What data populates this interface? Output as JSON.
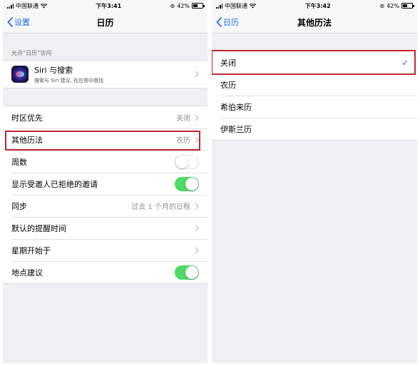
{
  "left": {
    "status": {
      "carrier": "中国联通",
      "time": "下午3:41",
      "battery": "42%"
    },
    "nav": {
      "back": "设置",
      "title": "日历"
    },
    "section_header": "允许“日历”访问",
    "siri": {
      "title": "Siri 与搜索",
      "subtitle": "搜索与 Siri 建议, 在应用中查找"
    },
    "rows": {
      "timezone": {
        "label": "时区优先",
        "value": "关闭"
      },
      "other_calendars": {
        "label": "其他历法",
        "value": "农历"
      },
      "week_numbers": {
        "label": "周数",
        "state": "off"
      },
      "declined": {
        "label": "显示受邀人已拒绝的邀请",
        "state": "on"
      },
      "sync": {
        "label": "同步",
        "value": "过去 1 个月的日程"
      },
      "default_alert": {
        "label": "默认的提醒时间"
      },
      "week_start": {
        "label": "星期开始于"
      },
      "location": {
        "label": "地点建议",
        "state": "on"
      }
    }
  },
  "right": {
    "status": {
      "carrier": "中国联通",
      "time": "下午3:42",
      "battery": "42%"
    },
    "nav": {
      "back": "日历",
      "title": "其他历法"
    },
    "options": [
      {
        "label": "关闭",
        "selected": true
      },
      {
        "label": "农历",
        "selected": false
      },
      {
        "label": "希伯来历",
        "selected": false
      },
      {
        "label": "伊斯兰历",
        "selected": false
      }
    ],
    "check": "✓"
  },
  "colors": {
    "accent": "#1a73e8",
    "switch_on": "#4cd964",
    "highlight": "#c0272d"
  }
}
